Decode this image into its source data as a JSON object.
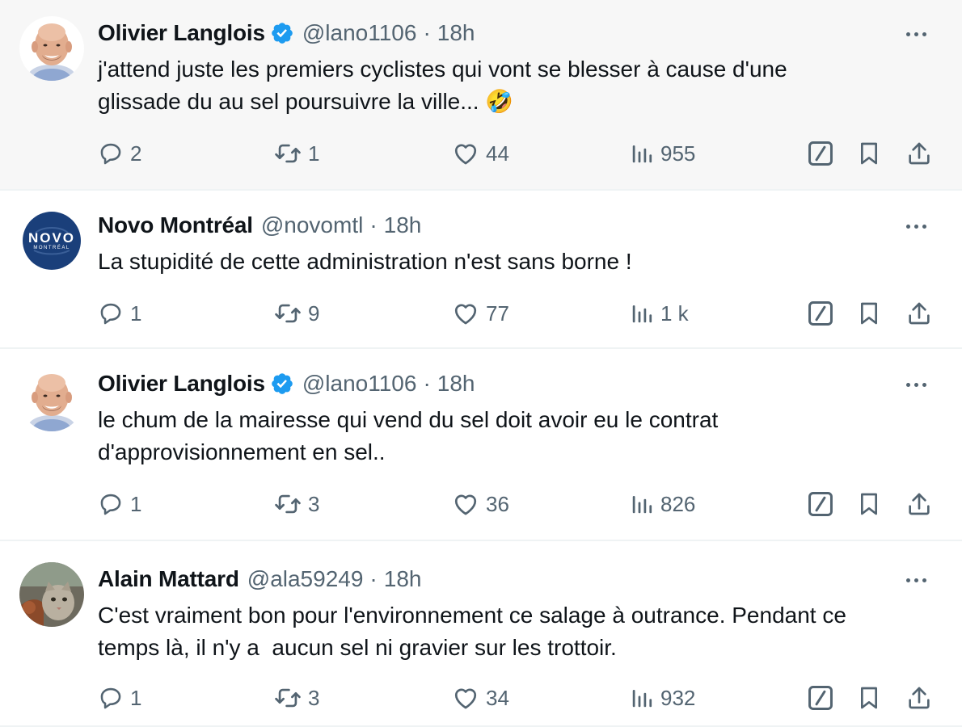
{
  "tweets": [
    {
      "name": "Olivier Langlois",
      "verified": true,
      "handle": "@lano1106",
      "separator": "·",
      "time": "18h",
      "lines": [
        "j'attend juste les premiers cyclistes qui vont se blesser à cause d'une",
        "glissade du au sel poursuivre la ville... 🤣"
      ],
      "replies": "2",
      "reposts": "1",
      "likes": "44",
      "views": "955",
      "avatar": "bald-man-avatar"
    },
    {
      "name": "Novo Montréal",
      "verified": false,
      "handle": "@novomtl",
      "separator": "·",
      "time": "18h",
      "lines": [
        "La stupidité de cette administration n'est sans borne !"
      ],
      "replies": "1",
      "reposts": "9",
      "likes": "77",
      "views": "1 k",
      "avatar": "novo-montreal-logo",
      "logo_text": "NOVO",
      "logo_sub": "MONTRÉAL"
    },
    {
      "name": "Olivier Langlois",
      "verified": true,
      "handle": "@lano1106",
      "separator": "·",
      "time": "18h",
      "lines": [
        "le chum de la mairesse qui vend du sel doit avoir eu le contrat",
        "d'approvisionnement en sel.."
      ],
      "replies": "1",
      "reposts": "3",
      "likes": "36",
      "views": "826",
      "avatar": "bald-man-avatar"
    },
    {
      "name": "Alain Mattard",
      "verified": false,
      "handle": "@ala59249",
      "separator": "·",
      "time": "18h",
      "lines": [
        "C'est vraiment bon pour l'environnement ce salage à outrance. Pendant ce",
        "temps là, il n'y a  aucun sel ni gravier sur les trottoir."
      ],
      "replies": "1",
      "reposts": "3",
      "likes": "34",
      "views": "932",
      "avatar": "cat-and-dog-avatar"
    }
  ],
  "colors": {
    "text": "#0f1419",
    "secondary": "#536471",
    "verified": "#1d9bf0",
    "divider": "#eff3f4",
    "highlight_bg": "#f7f7f7",
    "novo_blue": "#1a3f7a"
  },
  "icons": [
    "reply-icon",
    "repost-icon",
    "like-icon",
    "views-icon",
    "grok-icon",
    "bookmark-icon",
    "share-icon",
    "more-icon",
    "verified-badge-icon"
  ]
}
